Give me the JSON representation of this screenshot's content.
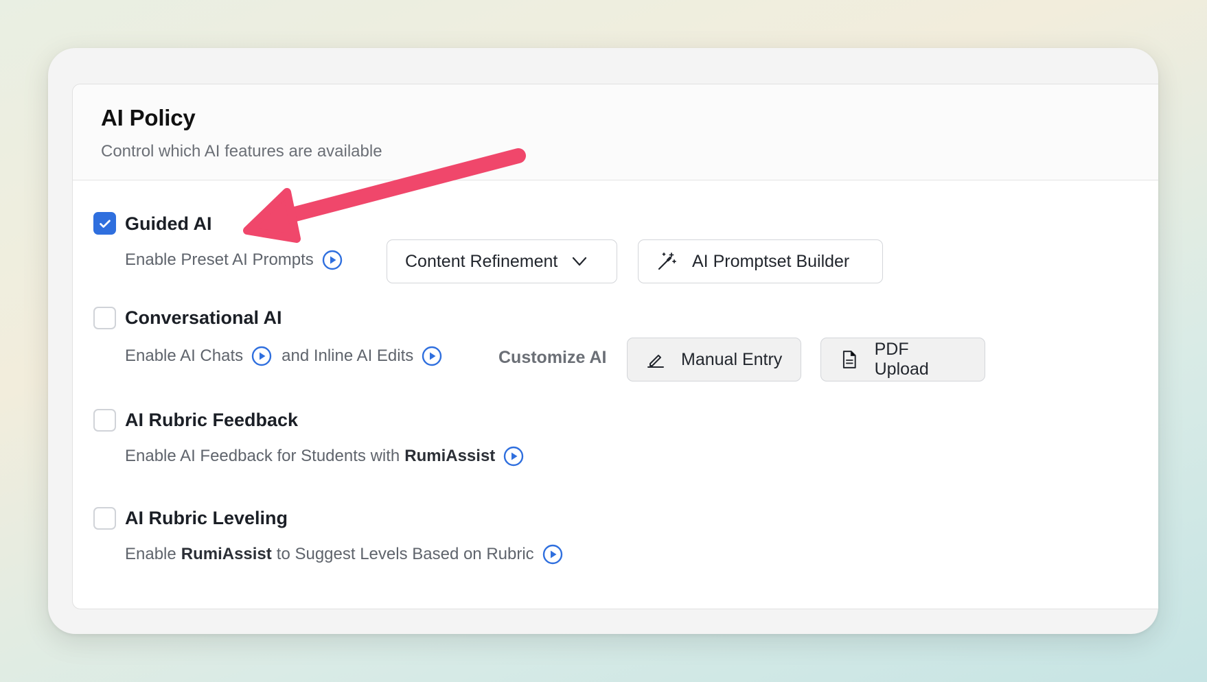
{
  "panel": {
    "title": "AI Policy",
    "subtitle": "Control which AI features are available"
  },
  "options": {
    "guided": {
      "label": "Guided AI",
      "checked": true,
      "desc": "Enable Preset AI Prompts",
      "dropdown_value": "Content Refinement",
      "builder_label": "AI Promptset Builder"
    },
    "conversational": {
      "label": "Conversational AI",
      "checked": false,
      "desc_a": "Enable AI Chats",
      "desc_b": "and Inline AI Edits",
      "customize_label": "Customize AI",
      "manual_label": "Manual Entry",
      "pdf_label": "PDF Upload"
    },
    "rubric_feedback": {
      "label": "AI Rubric Feedback",
      "checked": false,
      "desc_prefix": "Enable AI Feedback for Students with",
      "desc_brand": "RumiAssist"
    },
    "rubric_leveling": {
      "label": "AI Rubric Leveling",
      "checked": false,
      "desc_prefix": "Enable",
      "desc_brand": "RumiAssist",
      "desc_suffix": "to Suggest Levels Based on Rubric"
    }
  },
  "colors": {
    "accent": "#2f6fde",
    "annotation_arrow": "#f0476b"
  },
  "icons": {
    "play": "play-circle-icon",
    "chevron": "chevron-down-icon",
    "wand": "magic-wand-icon",
    "pencil": "pencil-icon",
    "document": "document-icon",
    "check": "checkmark-icon"
  }
}
